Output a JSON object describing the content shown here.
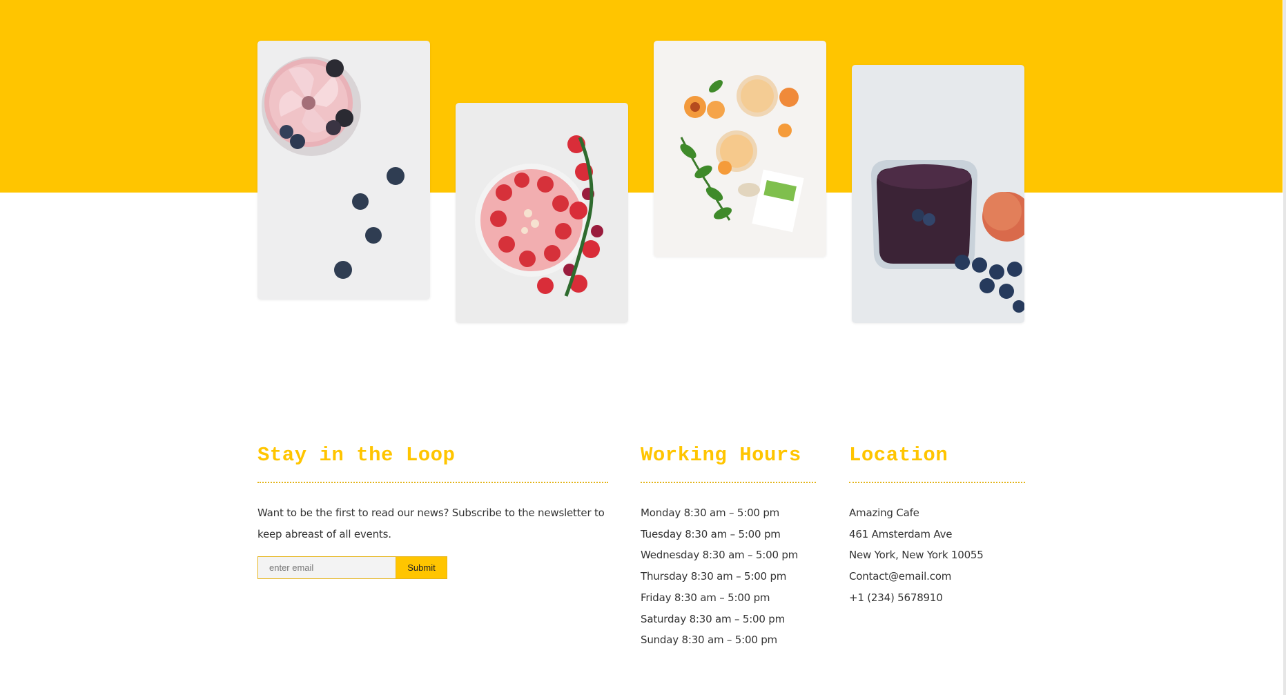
{
  "colors": {
    "accent": "#ffc500",
    "text": "#333333",
    "page_background": "#ffffff"
  },
  "gallery": [
    {
      "name": "berry-smoothie-flower-photo"
    },
    {
      "name": "strawberry-bowl-photo"
    },
    {
      "name": "peach-smoothie-photo"
    },
    {
      "name": "blueberry-smoothie-photo"
    }
  ],
  "newsletter": {
    "title": "Stay in the Loop",
    "text": "Want to be the first to read our news? Subscribe to the newsletter to keep abreast of all events.",
    "email_placeholder": "enter email",
    "email_value": "",
    "submit_label": "Submit"
  },
  "hours": {
    "title": "Working Hours",
    "lines": [
      "Monday 8:30 am – 5:00 pm",
      "Tuesday 8:30 am – 5:00 pm",
      "Wednesday 8:30 am – 5:00 pm",
      "Thursday 8:30 am – 5:00 pm",
      "Friday 8:30 am – 5:00 pm",
      "Saturday 8:30 am – 5:00 pm",
      "Sunday 8:30 am – 5:00 pm"
    ]
  },
  "location": {
    "title": "Location",
    "lines": [
      "Amazing Cafe",
      "461 Amsterdam Ave",
      "New York, New York 10055",
      "Contact@email.com",
      "+1 (234) 5678910"
    ]
  }
}
